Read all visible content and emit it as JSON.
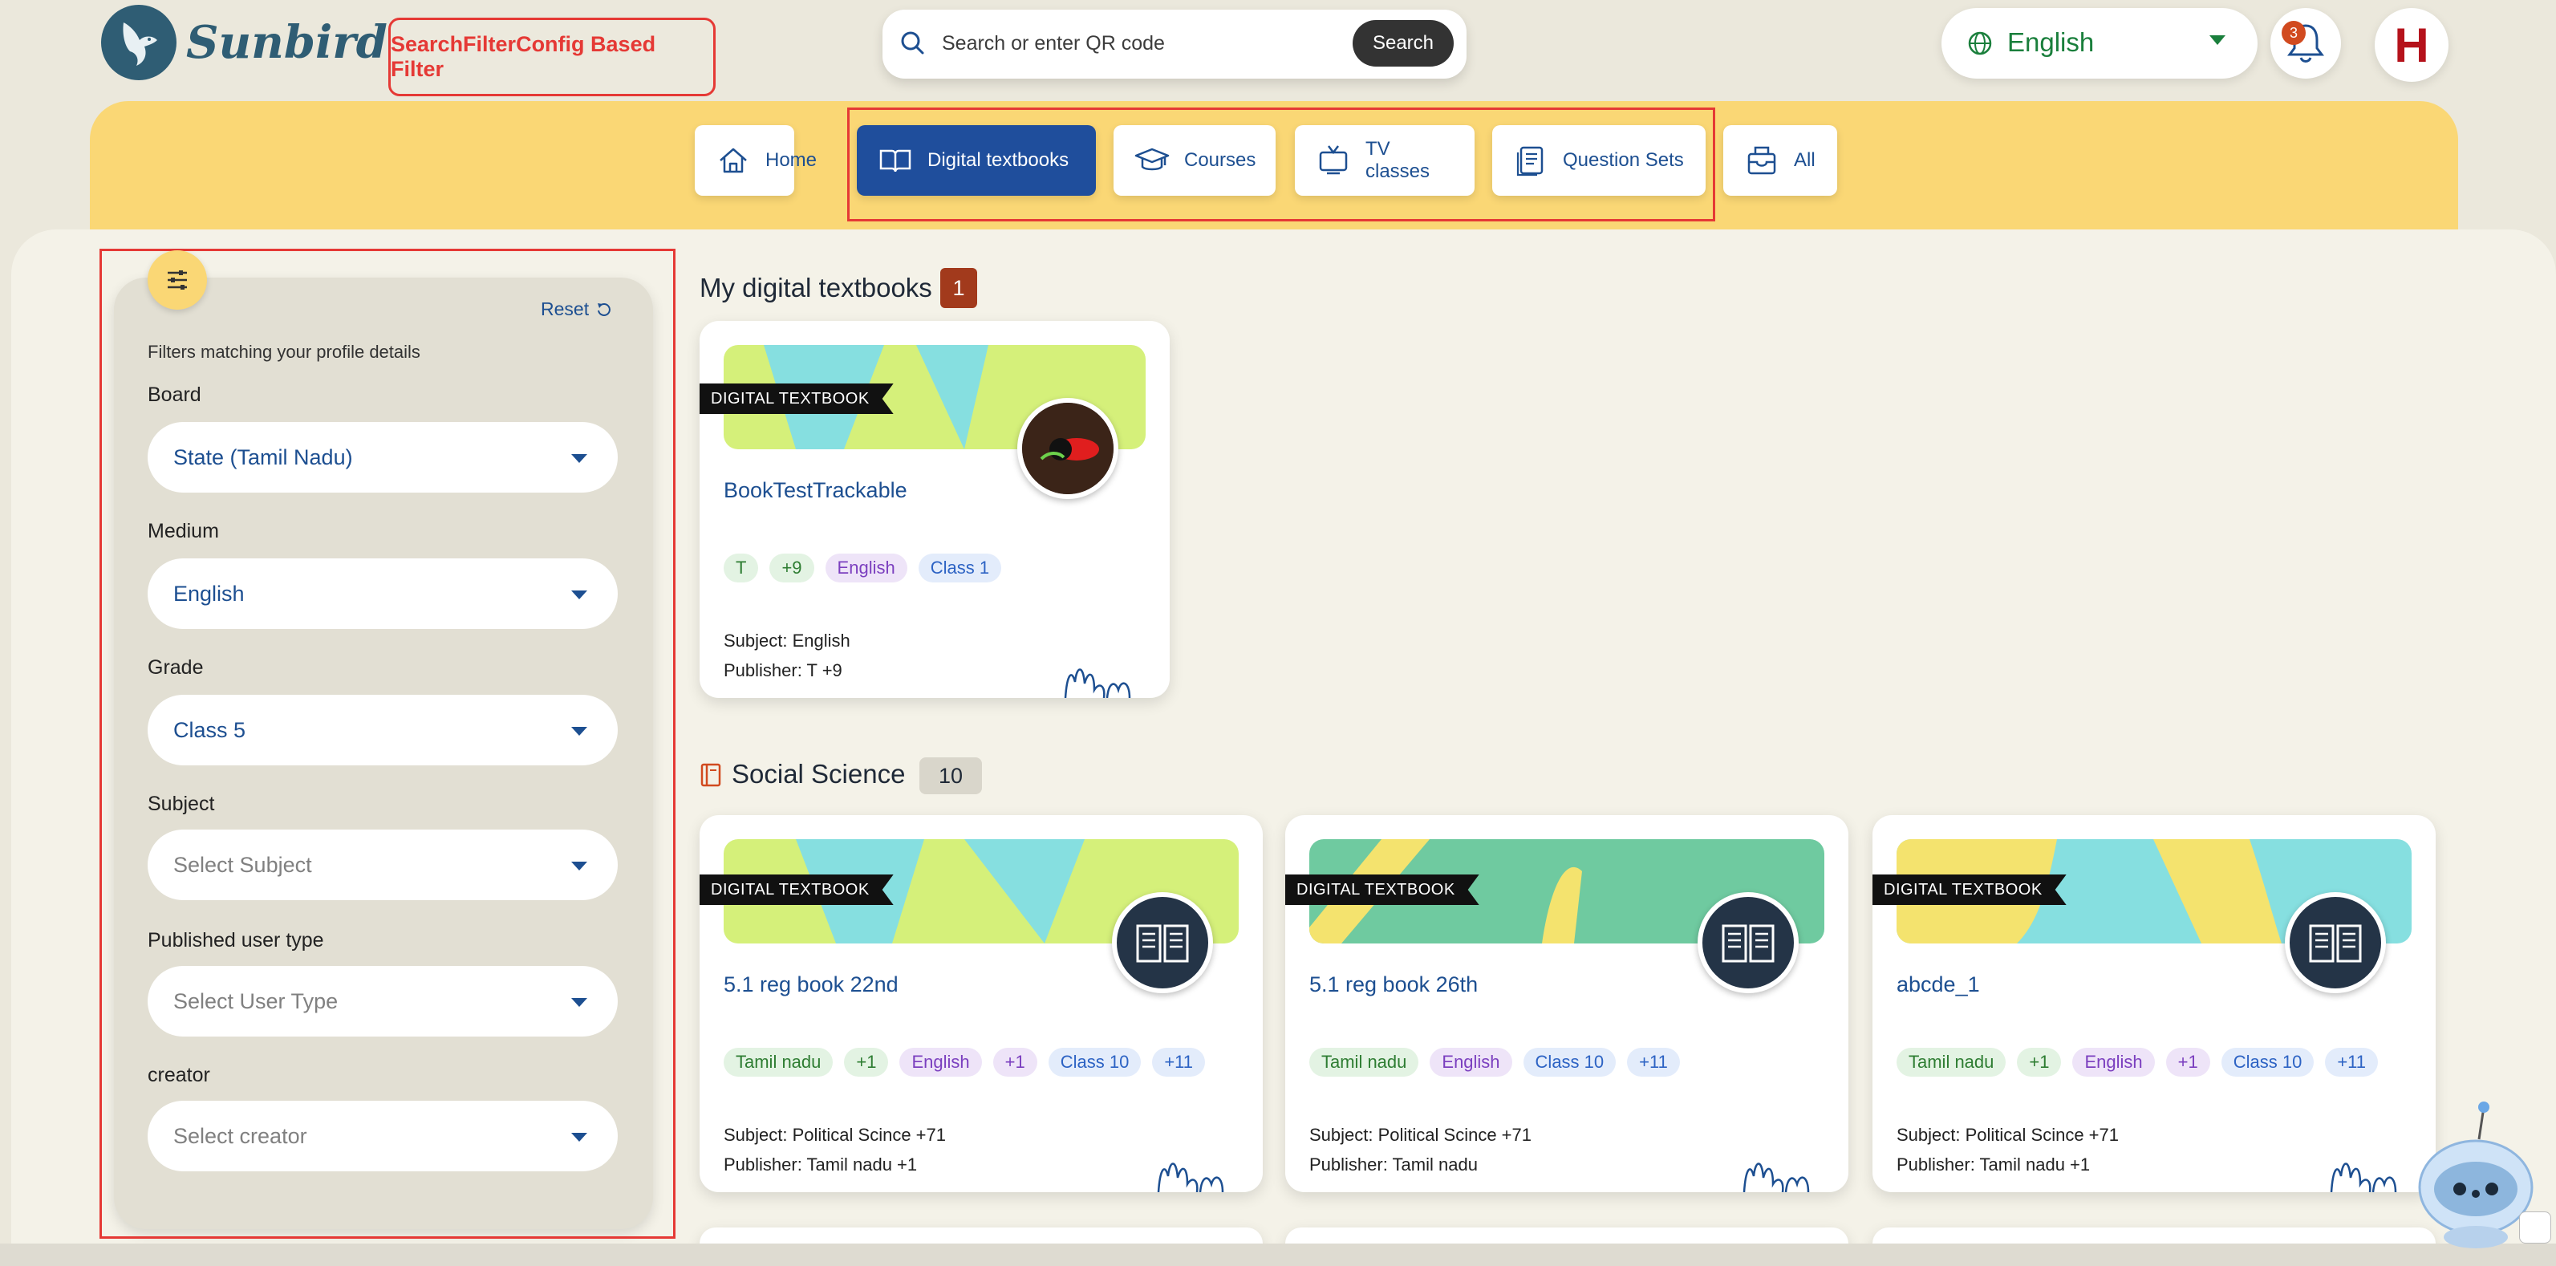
{
  "header": {
    "brand": "Sunbird",
    "annotation_label": "SearchFilterConfig Based Filter",
    "search_placeholder": "Search or enter QR code",
    "search_button": "Search",
    "language": "English",
    "notification_count": "3",
    "avatar_initial": "H"
  },
  "nav": {
    "tabs": [
      {
        "label": "Home",
        "icon": "home-icon"
      },
      {
        "label": "Digital textbooks",
        "icon": "book-open-icon"
      },
      {
        "label": "Courses",
        "icon": "graduation-cap-icon"
      },
      {
        "label": "TV classes",
        "icon": "tv-icon"
      },
      {
        "label": "Question Sets",
        "icon": "document-icon"
      },
      {
        "label": "All",
        "icon": "inbox-icon"
      }
    ],
    "active_tab": "Digital textbooks"
  },
  "filters": {
    "reset_label": "Reset",
    "hint": "Filters matching your profile details",
    "fields": [
      {
        "label": "Board",
        "value": "State (Tamil Nadu)"
      },
      {
        "label": "Medium",
        "value": "English"
      },
      {
        "label": "Grade",
        "value": "Class 5"
      },
      {
        "label": "Subject",
        "placeholder": "Select Subject"
      },
      {
        "label": "Published user type",
        "placeholder": "Select User Type"
      },
      {
        "label": "creator",
        "placeholder": "Select creator"
      }
    ]
  },
  "sections": [
    {
      "title": "My digital textbooks",
      "count": "1",
      "cards": [
        {
          "ribbon": "DIGITAL TEXTBOOK",
          "title": "BookTestTrackable",
          "chips": [
            "T",
            "+9",
            "English",
            "Class 1"
          ],
          "subject": "Subject: English",
          "publisher": "Publisher: T +9"
        }
      ]
    },
    {
      "title": "Social Science",
      "count": "10",
      "cards": [
        {
          "ribbon": "DIGITAL TEXTBOOK",
          "title": "5.1 reg book 22nd",
          "chips": [
            "Tamil nadu",
            "+1",
            "English",
            "+1",
            "Class 10",
            "+11"
          ],
          "subject": "Subject: Political Scince +71",
          "publisher": "Publisher: Tamil nadu +1"
        },
        {
          "ribbon": "DIGITAL TEXTBOOK",
          "title": "5.1 reg book 26th",
          "chips": [
            "Tamil nadu",
            "English",
            "Class 10",
            "+11"
          ],
          "subject": "Subject: Political Scince +71",
          "publisher": "Publisher: Tamil nadu"
        },
        {
          "ribbon": "DIGITAL TEXTBOOK",
          "title": "abcde_1",
          "chips": [
            "Tamil nadu",
            "+1",
            "English",
            "+1",
            "Class 10",
            "+11"
          ],
          "subject": "Subject: Political Scince +71",
          "publisher": "Publisher: Tamil nadu +1"
        }
      ]
    }
  ],
  "colors": {
    "accent_blue": "#1f4e9c",
    "band_yellow": "#fad775",
    "annotation_red": "#e53935",
    "count_badge": "#a23a1c"
  }
}
